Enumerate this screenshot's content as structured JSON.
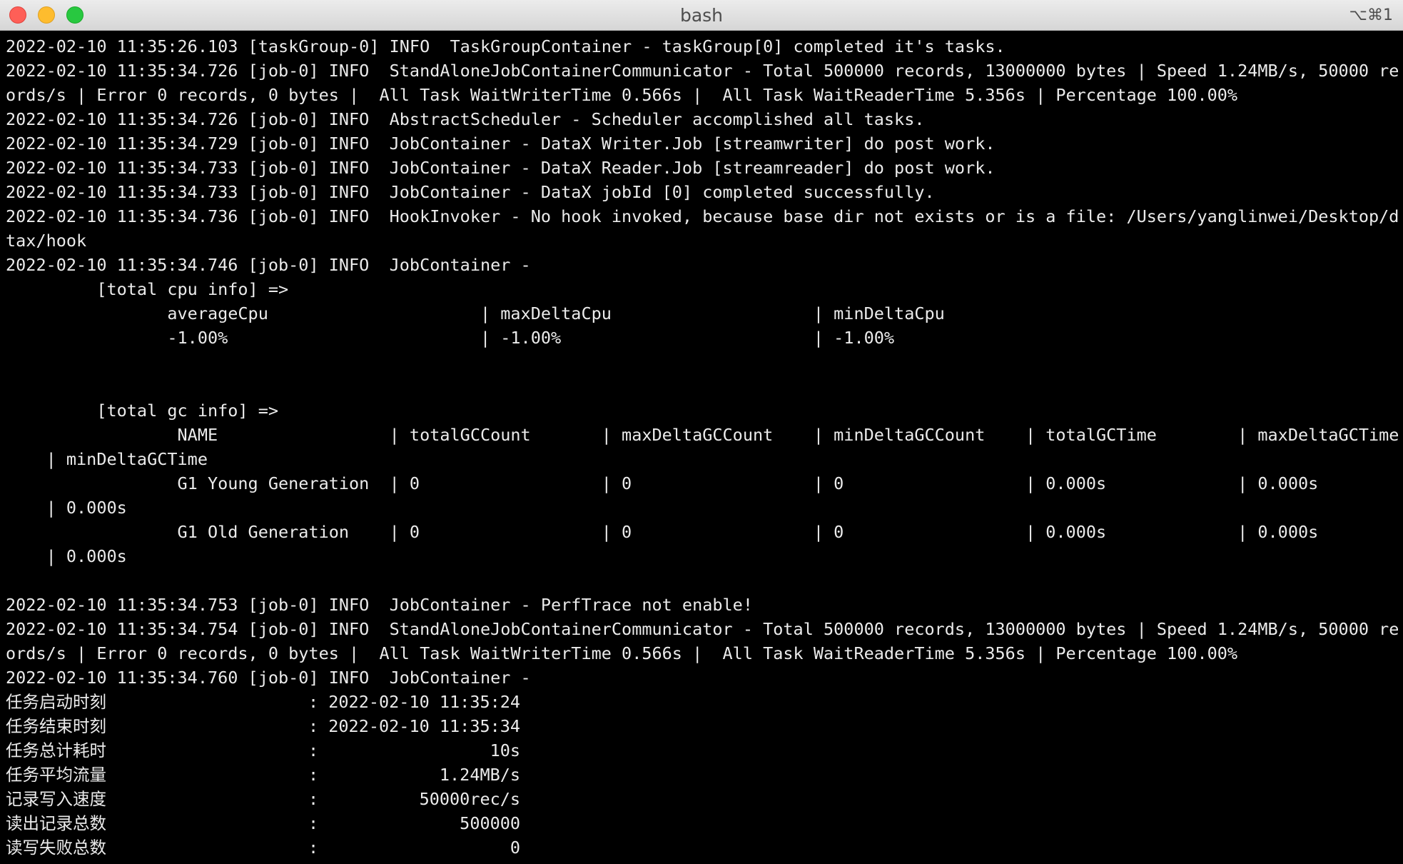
{
  "window": {
    "title": "bash",
    "shortcut": "⌥⌘1",
    "colors": {
      "background": "#000000",
      "text": "#ebebeb",
      "close": "#fe5f57",
      "minimize": "#febc2e",
      "maximize": "#28c840"
    }
  },
  "terminal": {
    "lines": [
      "2022-02-10 11:35:26.103 [taskGroup-0] INFO  TaskGroupContainer - taskGroup[0] completed it's tasks.",
      "2022-02-10 11:35:34.726 [job-0] INFO  StandAloneJobContainerCommunicator - Total 500000 records, 13000000 bytes | Speed 1.24MB/s, 50000 rec",
      "ords/s | Error 0 records, 0 bytes |  All Task WaitWriterTime 0.566s |  All Task WaitReaderTime 5.356s | Percentage 100.00%",
      "2022-02-10 11:35:34.726 [job-0] INFO  AbstractScheduler - Scheduler accomplished all tasks.",
      "2022-02-10 11:35:34.729 [job-0] INFO  JobContainer - DataX Writer.Job [streamwriter] do post work.",
      "2022-02-10 11:35:34.733 [job-0] INFO  JobContainer - DataX Reader.Job [streamreader] do post work.",
      "2022-02-10 11:35:34.733 [job-0] INFO  JobContainer - DataX jobId [0] completed successfully.",
      "2022-02-10 11:35:34.736 [job-0] INFO  HookInvoker - No hook invoked, because base dir not exists or is a file: /Users/yanglinwei/Desktop/da",
      "tax/hook",
      "2022-02-10 11:35:34.746 [job-0] INFO  JobContainer -",
      "\t [total cpu info] =>",
      "\t\taverageCpu                     | maxDeltaCpu                    | minDeltaCpu",
      "\t\t-1.00%                         | -1.00%                         | -1.00%",
      "",
      "",
      "\t [total gc info] =>",
      "\t\t NAME                 | totalGCCount       | maxDeltaGCCount    | minDeltaGCCount    | totalGCTime        | maxDeltaGCTime",
      "    | minDeltaGCTime",
      "\t\t G1 Young Generation  | 0                  | 0                  | 0                  | 0.000s             | 0.000s",
      "    | 0.000s",
      "\t\t G1 Old Generation    | 0                  | 0                  | 0                  | 0.000s             | 0.000s",
      "    | 0.000s",
      "",
      "2022-02-10 11:35:34.753 [job-0] INFO  JobContainer - PerfTrace not enable!",
      "2022-02-10 11:35:34.754 [job-0] INFO  StandAloneJobContainerCommunicator - Total 500000 records, 13000000 bytes | Speed 1.24MB/s, 50000 rec",
      "ords/s | Error 0 records, 0 bytes |  All Task WaitWriterTime 0.566s |  All Task WaitReaderTime 5.356s | Percentage 100.00%",
      "2022-02-10 11:35:34.760 [job-0] INFO  JobContainer -",
      "任务启动时刻                    : 2022-02-10 11:35:24",
      "任务结束时刻                    : 2022-02-10 11:35:34",
      "任务总计耗时                    :                 10s",
      "任务平均流量                    :            1.24MB/s",
      "记录写入速度                    :          50000rec/s",
      "读出记录总数                    :              500000",
      "读写失败总数                    :                   0"
    ]
  }
}
